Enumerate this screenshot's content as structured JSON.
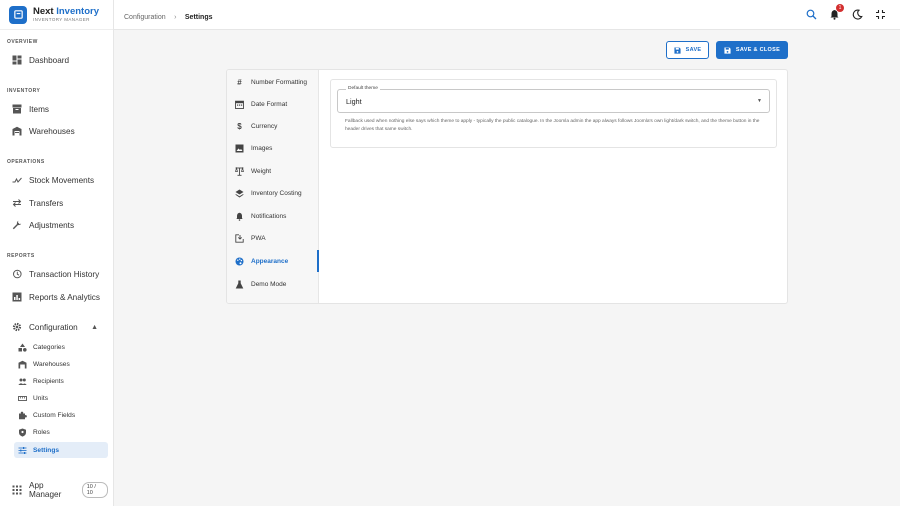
{
  "brand": {
    "name_part1": "Next",
    "name_part2": "Inventory",
    "subtitle": "INVENTORY MANAGER"
  },
  "sidebar": {
    "overview_label": "OVERVIEW",
    "dashboard": "Dashboard",
    "inventory_label": "INVENTORY",
    "items": "Items",
    "warehouses": "Warehouses",
    "operations_label": "OPERATIONS",
    "stock_movements": "Stock Movements",
    "transfers": "Transfers",
    "adjustments": "Adjustments",
    "reports_label": "REPORTS",
    "transaction_history": "Transaction History",
    "reports_analytics": "Reports & Analytics",
    "configuration": "Configuration",
    "config_children": {
      "categories": "Categories",
      "warehouses": "Warehouses",
      "recipients": "Recipients",
      "units": "Units",
      "custom_fields": "Custom Fields",
      "roles": "Roles",
      "settings": "Settings"
    },
    "app_manager": "App Manager",
    "app_manager_count": "10 / 10"
  },
  "topbar": {
    "breadcrumb_parent": "Configuration",
    "breadcrumb_separator": "›",
    "breadcrumb_current": "Settings",
    "notification_count": "1"
  },
  "actions": {
    "save": "SAVE",
    "save_close": "SAVE & CLOSE"
  },
  "settings_tabs": {
    "number_formatting": "Number Formatting",
    "date_format": "Date Format",
    "currency": "Currency",
    "images": "Images",
    "weight": "Weight",
    "inventory_costing": "Inventory Costing",
    "notifications": "Notifications",
    "pwa": "PWA",
    "appearance": "Appearance",
    "demo_mode": "Demo Mode"
  },
  "appearance": {
    "default_theme_label": "Default theme",
    "default_theme_value": "Light",
    "helper": "Fallback used when nothing else says which theme to apply - typically the public catalogue. In the Joomla admin the app always follows Joomla's own light/dark switch, and the theme button in the header drives that same switch."
  },
  "colors": {
    "accent": "#1e6fc9",
    "badge": "#d32f2f"
  }
}
